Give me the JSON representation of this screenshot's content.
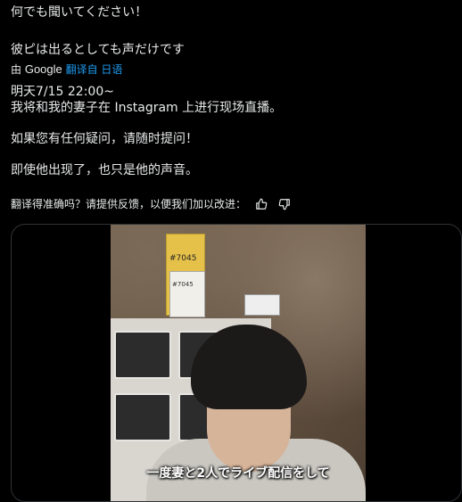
{
  "post": {
    "original_line_1": "何でも聞いてください！",
    "original_line_2": "彼ピは出るとしても声だけです",
    "attribution_prefix": "由",
    "attribution_provider": "Google",
    "attribution_link": "翻译自 日语",
    "translated_line_1": "明天7/15 22:00~",
    "translated_line_2": "我将和我的妻子在 Instagram 上进行现场直播。",
    "translated_line_3": "如果您有任何疑问，请随时提问！",
    "translated_line_4": "即使他出现了，也只是他的声音。",
    "feedback_prompt": "翻译得准确吗？请提供反馈，以便我们加以改进："
  },
  "media": {
    "subtitle": "一度妻と2人でライブ配信をして",
    "box_label_1": "#7045",
    "box_label_2": "#7045"
  },
  "icons": {
    "thumbs_up": "thumbs-up-icon",
    "thumbs_down": "thumbs-down-icon"
  },
  "colors": {
    "background": "#000000",
    "text": "#e7e9ea",
    "link": "#1d9bf0",
    "border": "#2f3336"
  }
}
